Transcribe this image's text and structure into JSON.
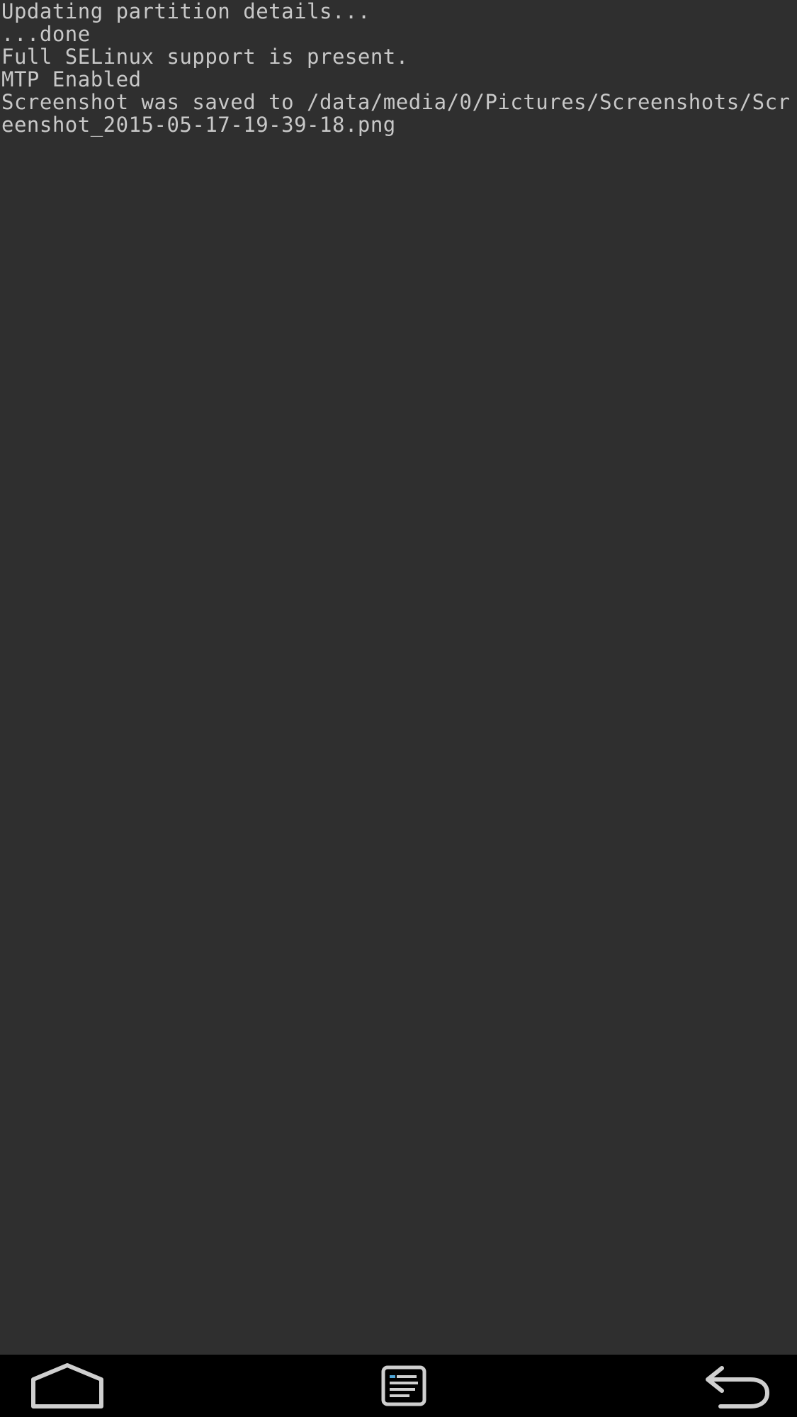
{
  "console": {
    "lines": [
      "Updating partition details...",
      "...done",
      "Full SELinux support is present.",
      "MTP Enabled",
      "Screenshot was saved to /data/media/0/Pictures/Screenshots/Scr",
      "eenshot_2015-05-17-19-39-18.png"
    ]
  },
  "navbar": {
    "home_icon": "home-icon",
    "console_icon": "console-log-icon",
    "back_icon": "back-arrow-icon"
  },
  "colors": {
    "background": "#2f2f2f",
    "text": "#c8c8c8",
    "navbar": "#000000",
    "icon": "#cfcfcf"
  }
}
